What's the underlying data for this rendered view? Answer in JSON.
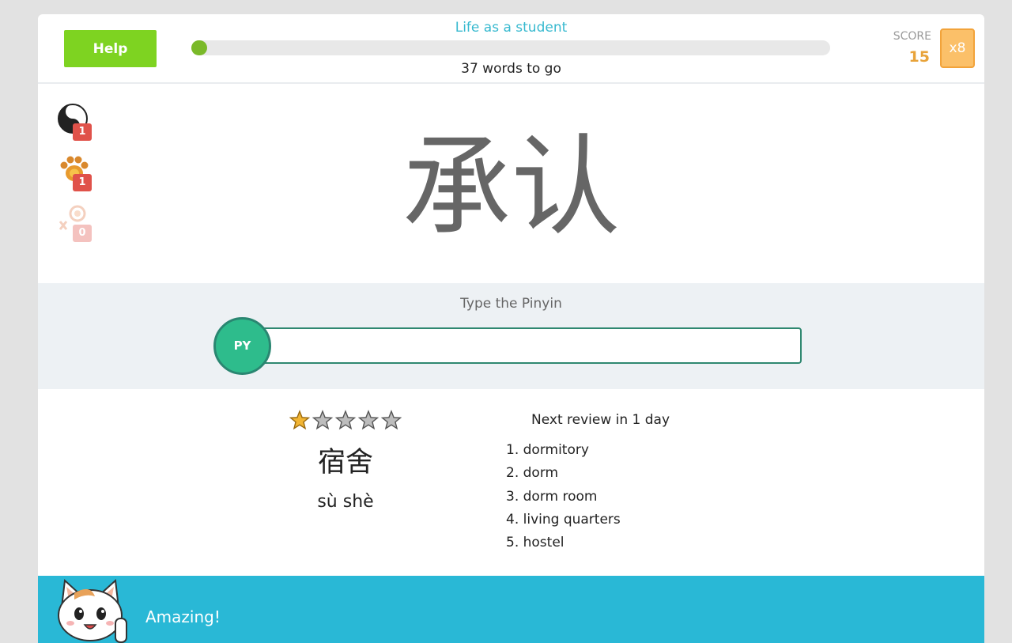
{
  "header": {
    "help_label": "Help",
    "course_title": "Life as a student",
    "words_to_go": "37 words to go",
    "progress_fraction": 0.01,
    "score_label": "SCORE",
    "score_value": "15",
    "multiplier": "x8"
  },
  "powerups": [
    {
      "icon": "yin-yang-icon",
      "count": "1"
    },
    {
      "icon": "paw-icon",
      "count": "1"
    },
    {
      "icon": "lock-icon",
      "count": "0"
    }
  ],
  "current_word": {
    "hanzi": "承认"
  },
  "input": {
    "prompt": "Type the Pinyin",
    "badge_label": "PY",
    "value": "",
    "placeholder": ""
  },
  "previous_word": {
    "rating": 1,
    "max_rating": 5,
    "hanzi": "宿舍",
    "pinyin": "sù shè",
    "next_review": "Next review in 1 day",
    "meanings": [
      "1. dormitory",
      "2. dorm",
      "3. dorm room",
      "4. living quarters",
      "5. hostel"
    ]
  },
  "feedback": {
    "message": "Amazing!",
    "mascot": "cat-mascot-icon"
  },
  "colors": {
    "help": "#7ed321",
    "progress": "#7ab929",
    "title": "#37b9cf",
    "score": "#e8a33a",
    "multiplier": "#fbc069",
    "py_badge": "#2ebc8c",
    "footer": "#29b8d6"
  }
}
